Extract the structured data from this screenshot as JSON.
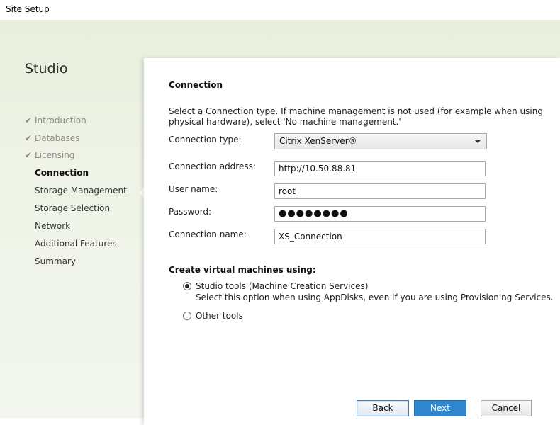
{
  "window": {
    "title": "Site Setup"
  },
  "sidebar": {
    "title": "Studio",
    "steps": [
      {
        "label": "Introduction",
        "state": "done"
      },
      {
        "label": "Databases",
        "state": "done"
      },
      {
        "label": "Licensing",
        "state": "done"
      },
      {
        "label": "Connection",
        "state": "current"
      },
      {
        "label": "Storage Management",
        "state": "pending"
      },
      {
        "label": "Storage Selection",
        "state": "pending"
      },
      {
        "label": "Network",
        "state": "pending"
      },
      {
        "label": "Additional Features",
        "state": "pending"
      },
      {
        "label": "Summary",
        "state": "pending"
      }
    ]
  },
  "main": {
    "title": "Connection",
    "description": "Select a Connection type. If machine management is not used (for example when using physical hardware), select 'No machine management.'",
    "fields": {
      "connection_type": {
        "label": "Connection type:",
        "value": "Citrix XenServer®"
      },
      "connection_address": {
        "label": "Connection address:",
        "value": "http://10.50.88.81"
      },
      "user_name": {
        "label": "User name:",
        "value": "root"
      },
      "password": {
        "label": "Password:",
        "value": "●●●●●●●●"
      },
      "connection_name": {
        "label": "Connection name:",
        "value": "XS_Connection"
      }
    },
    "vm_section": {
      "title": "Create virtual machines using:",
      "option_studio": {
        "label": "Studio tools (Machine Creation Services)",
        "help": "Select this option when using AppDisks, even if you are using Provisioning Services.",
        "selected": true
      },
      "option_other": {
        "label": "Other tools",
        "selected": false
      }
    },
    "buttons": {
      "back": "Back",
      "next": "Next",
      "cancel": "Cancel"
    }
  },
  "icons": {
    "check": "checkmark-icon",
    "dropdown": "chevron-down-icon"
  }
}
